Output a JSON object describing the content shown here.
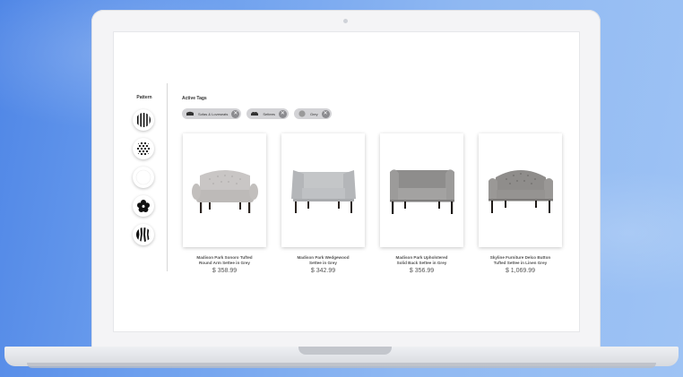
{
  "colors": {
    "background": "#6ea0ee",
    "tag_bg": "#d3d3d6",
    "tag_close": "#8b8b8f",
    "sofa_grey": "#9a9a9a"
  },
  "filters": {
    "pattern_label": "Pattern",
    "swatches": [
      {
        "name": "vertical-stripes-swatch-icon"
      },
      {
        "name": "polka-dot-swatch-icon"
      },
      {
        "name": "solid-white-swatch-icon"
      },
      {
        "name": "floral-swatch-icon"
      },
      {
        "name": "zebra-swatch-icon"
      }
    ]
  },
  "active_tags": {
    "label": "Active Tags",
    "items": [
      {
        "label": "Sofas & Loveseats",
        "icon": "sofa-icon"
      },
      {
        "label": "Settees",
        "icon": "settee-icon"
      },
      {
        "label": "Grey",
        "icon": "grey-color-icon"
      }
    ]
  },
  "products": [
    {
      "name_line1": "Madison Park Sonoro Tufted",
      "name_line2": "Round Arm Settee in Grey",
      "price": "$ 358.99"
    },
    {
      "name_line1": "Madison Park Wedgewood",
      "name_line2": "Settee in Grey",
      "price": "$ 342.99"
    },
    {
      "name_line1": "Madison Park Upholstered",
      "name_line2": "Solid Back Settee in Grey",
      "price": "$ 356.99"
    },
    {
      "name_line1": "Skyline Furniture Delco Button",
      "name_line2": "Tufted Settee in Linen Grey",
      "price": "$ 1,069.99"
    }
  ]
}
